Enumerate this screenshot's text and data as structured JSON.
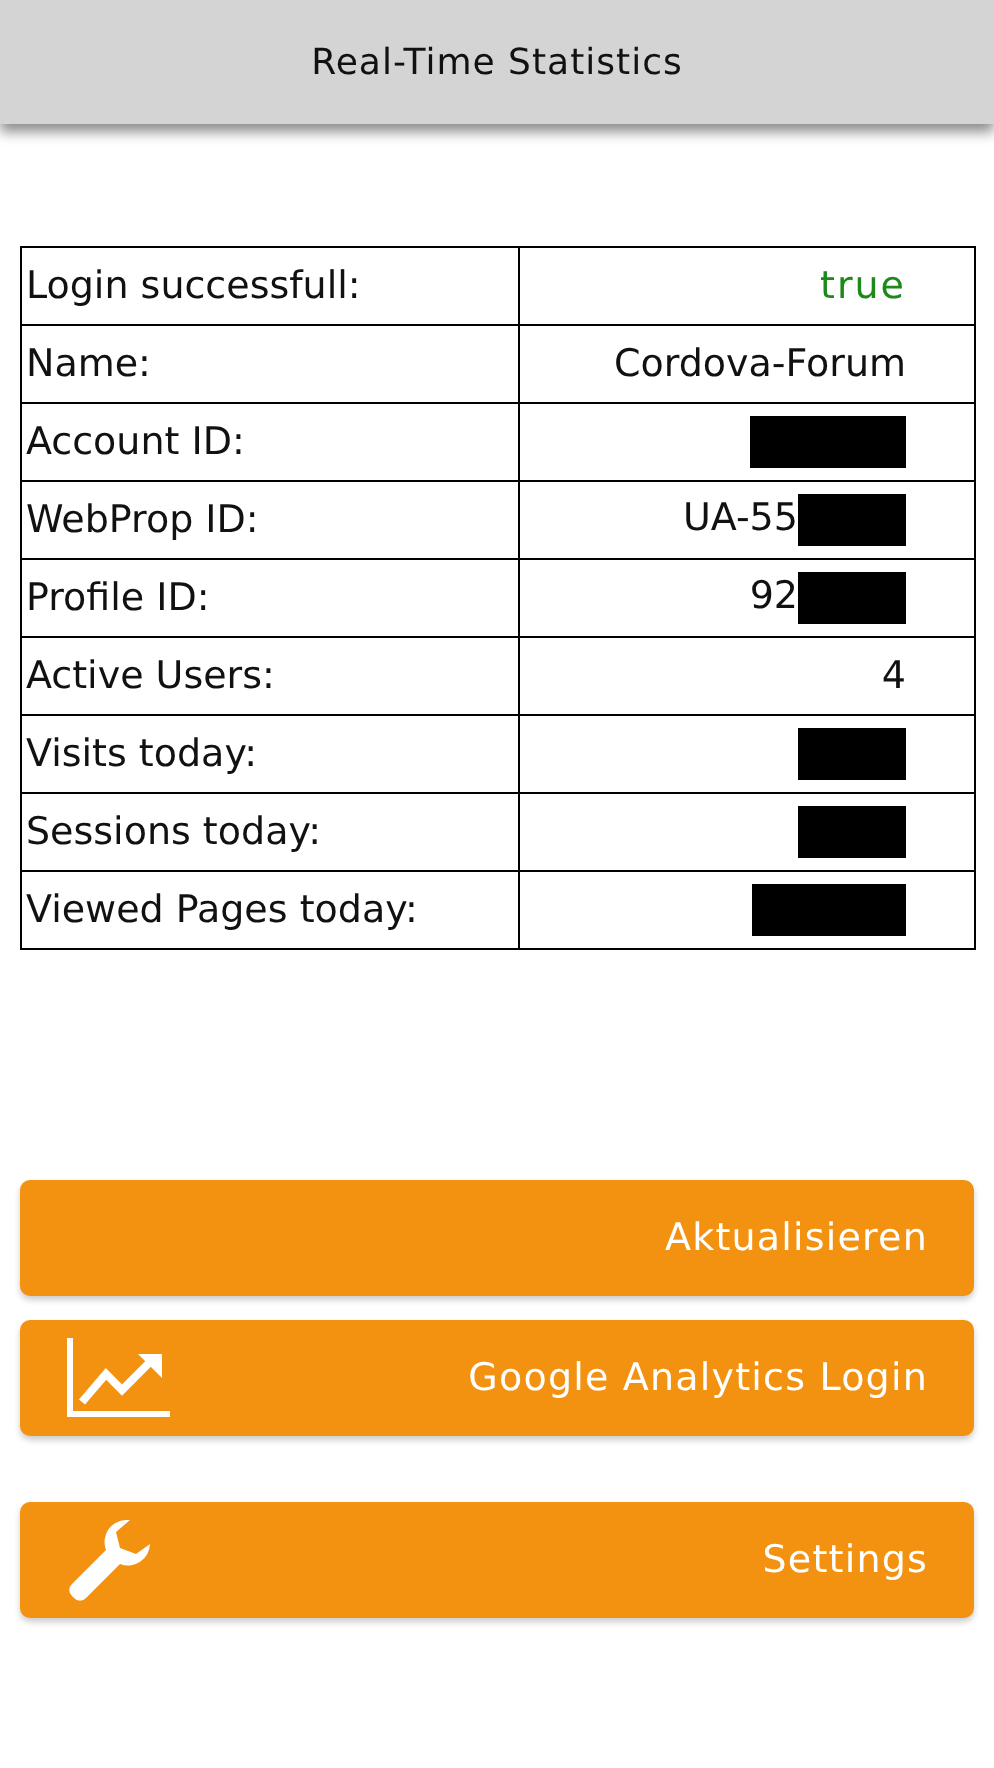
{
  "header": {
    "title": "Real-Time Statistics"
  },
  "table": {
    "rows": [
      {
        "label": "Login successfull:",
        "value": "true",
        "kind": "status"
      },
      {
        "label": "Name:",
        "value": "Cordova-Forum",
        "kind": "text"
      },
      {
        "label": "Account ID:",
        "kind": "redacted"
      },
      {
        "label": "WebProp ID:",
        "value": "UA-55",
        "kind": "redacted"
      },
      {
        "label": "Profile ID:",
        "value": "92",
        "kind": "redacted"
      },
      {
        "label": "Active Users:",
        "value": "4",
        "kind": "text"
      },
      {
        "label": "Visits today:",
        "kind": "redacted"
      },
      {
        "label": "Sessions today:",
        "kind": "redacted"
      },
      {
        "label": "Viewed Pages today:",
        "kind": "redacted"
      }
    ]
  },
  "buttons": [
    {
      "label": "Aktualisieren",
      "kind": "plain"
    },
    {
      "label": "Google Analytics Login",
      "kind": "chart"
    },
    {
      "label": "Settings",
      "kind": "wrench"
    }
  ]
}
